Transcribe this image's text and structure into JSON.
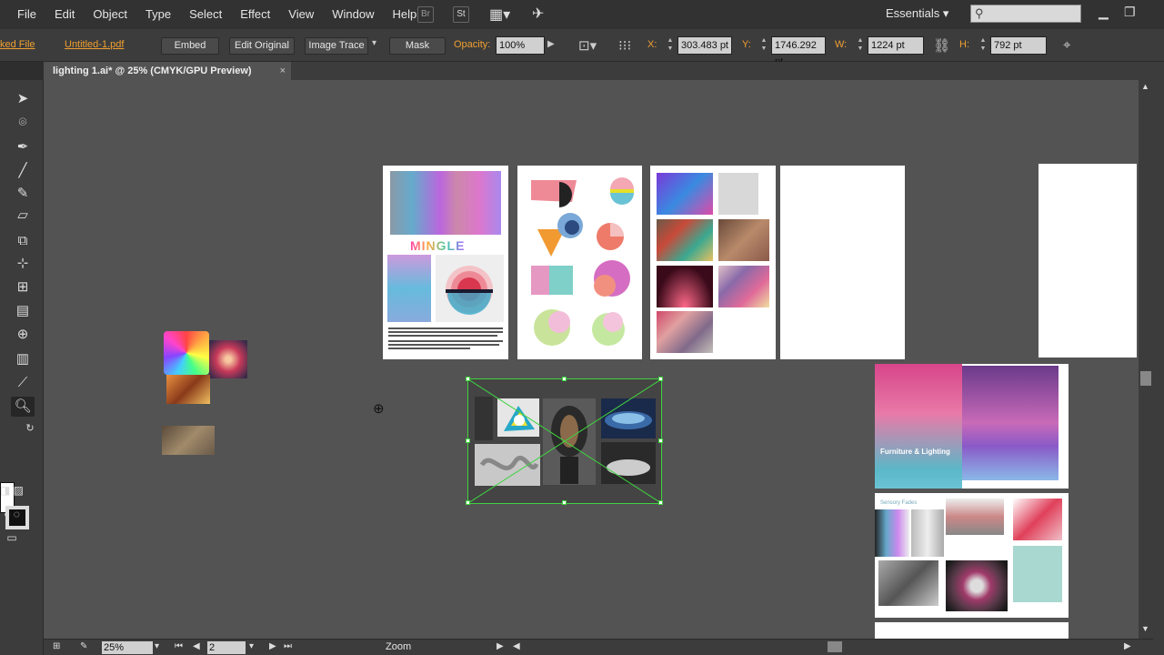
{
  "menubar": {
    "items": [
      "File",
      "Edit",
      "Object",
      "Type",
      "Select",
      "Effect",
      "View",
      "Window",
      "Help"
    ],
    "bridge_label": "Br",
    "stock_label": "St",
    "workspace": "Essentials"
  },
  "controlbar": {
    "linked_file": "ked File",
    "file_name": "Untitled-1.pdf",
    "embed": "Embed",
    "edit_original": "Edit Original",
    "image_trace": "Image Trace",
    "mask": "Mask",
    "opacity_label": "Opacity:",
    "opacity_value": "100%",
    "x_label": "X:",
    "x_value": "303.483 pt",
    "y_label": "Y:",
    "y_value": "1746.292 pt",
    "w_label": "W:",
    "w_value": "1224 pt",
    "h_label": "H:",
    "h_value": "792 pt"
  },
  "document": {
    "tab_title": "lighting 1.ai* @ 25% (CMYK/GPU Preview)"
  },
  "artwork": {
    "mingle_text": "MINGLE",
    "brochure_title": "Furniture & Lighting",
    "brochure_heading": "Sensory Fades"
  },
  "statusbar": {
    "zoom": "25%",
    "page": "2",
    "tool_label": "Zoom"
  },
  "colors": {
    "selection": "#3fd23f",
    "accent": "#f0a030"
  }
}
